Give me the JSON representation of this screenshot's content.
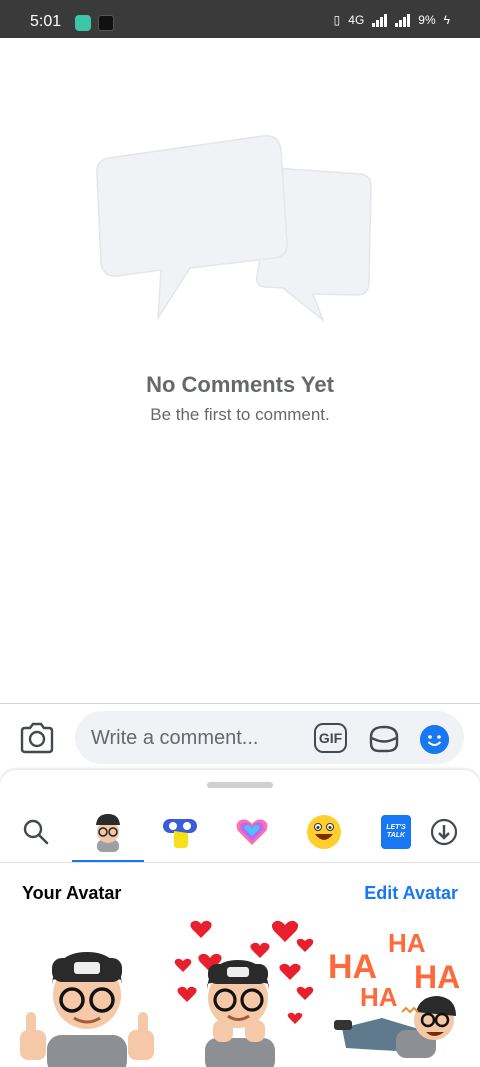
{
  "status_bar": {
    "time": "5:01",
    "battery": "9%",
    "network": "4G"
  },
  "empty_state": {
    "title": "No Comments Yet",
    "subtitle": "Be the first to comment."
  },
  "comment_bar": {
    "placeholder": "Write a comment...",
    "gif_label": "GIF"
  },
  "sticker_panel": {
    "tabs": [
      "search-icon",
      "avatar",
      "wave-sticker",
      "rainbow-heart",
      "smiley-face",
      "lets-talk"
    ],
    "selected_tab": "avatar",
    "lets_talk_text": "LET'S TALK",
    "section_title": "Your Avatar",
    "edit_link": "Edit Avatar",
    "sticker_texts": [
      "HA",
      "HA",
      "HA",
      "HA"
    ]
  },
  "colors": {
    "accent": "#1877f2",
    "status_bar": "#3a3a3a",
    "muted_text": "#65686c"
  }
}
